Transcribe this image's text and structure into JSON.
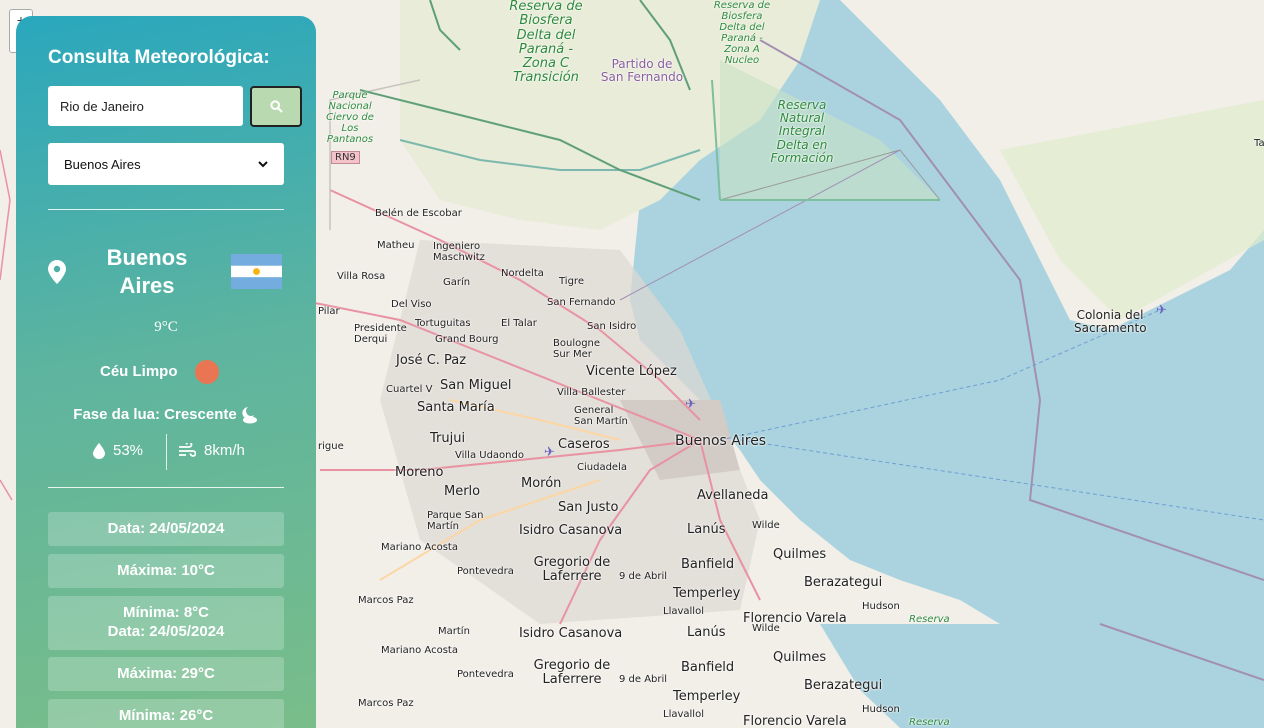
{
  "map": {
    "labels": {
      "reserva1": "Reserva de Biosfera Delta del Paraná - Zona C Transición",
      "reserva2": "Reserva de Biosfera Delta del Paraná - Zona A Nucleo",
      "reserva3": "Reserva Natural Integral Delta en Formación",
      "partido": "Partido de San Fernando",
      "parque": "Parque Nacional Ciervo de Los Pantanos",
      "rn9": "RN9",
      "belen": "Belén de Escobar",
      "matheu": "Matheu",
      "ingeniero": "Ingeniero Maschwitz",
      "villarosa": "Villa Rosa",
      "nordelta": "Nordelta",
      "tigre": "Tigre",
      "garin": "Garín",
      "delviso": "Del Viso",
      "sanfernando": "San Fernando",
      "pilar": "Pilar",
      "tortuguitas": "Tortuguitas",
      "eltalar": "El Talar",
      "sanisidro": "San Isidro",
      "presidente": "Presidente Derqui",
      "grandbourg": "Grand Bourg",
      "boulogne": "Boulogne Sur Mer",
      "josecpaz": "José C. Paz",
      "vicentelopez": "Vicente López",
      "cuartelv": "Cuartel V",
      "sanmiguel": "San Miguel",
      "villaballester": "Villa Ballester",
      "santamaria": "Santa María",
      "generalsanmartin": "General San Martín",
      "trujui": "Trujui",
      "caseros": "Caseros",
      "buenosaires": "Buenos Aires",
      "rodriguez": "rigue",
      "villaudaondo": "Villa Udaondo",
      "ciudadela": "Ciudadela",
      "moreno": "Moreno",
      "merlo": "Merlo",
      "moron": "Morón",
      "avellaneda": "Avellaneda",
      "parquesanmartin": "Parque San Martín",
      "sanjusto": "San Justo",
      "lanus": "Lanús",
      "wilde": "Wilde",
      "marianoacosta": "Mariano Acosta",
      "isidro": "Isidro Casanova",
      "quilmes": "Quilmes",
      "pontevedra": "Pontevedra",
      "gregorio": "Gregorio de Laferrere",
      "nuevedeabril": "9 de Abril",
      "banfield": "Banfield",
      "berazategui": "Berazategui",
      "marcospaz": "Marcos Paz",
      "temperley": "Temperley",
      "hudson": "Hudson",
      "llavallol": "Llavallol",
      "florencio": "Florencio Varela",
      "reserva": "Reserva",
      "colonia": "Colonia del Sacramento",
      "martin": "Martín",
      "ta": "Ta"
    },
    "zoom_in": "+",
    "zoom_out": "−"
  },
  "panel": {
    "title": "Consulta Meteorológica:",
    "search": {
      "value": "Rio de Janeiro"
    },
    "select": {
      "value": "Buenos Aires"
    },
    "city": "Buenos Aires",
    "temperature": "9°C",
    "description": "Céu Limpo",
    "moon_phase": "Fase da lua: Crescente",
    "humidity": "53%",
    "wind": "8km/h",
    "forecast": [
      {
        "date": "Data: 24/05/2024",
        "max": "Máxima: 10°C",
        "min": "Mínima: 8°C"
      },
      {
        "date": "Data: 24/05/2024",
        "max": "Máxima: 29°C",
        "min": "Mínima: 26°C"
      }
    ]
  },
  "colors": {
    "panel_top": "#2aa7bd",
    "panel_bottom": "#7bbe88",
    "sun": "#ea7552",
    "water": "#aad3df",
    "land": "#f2efe9"
  }
}
